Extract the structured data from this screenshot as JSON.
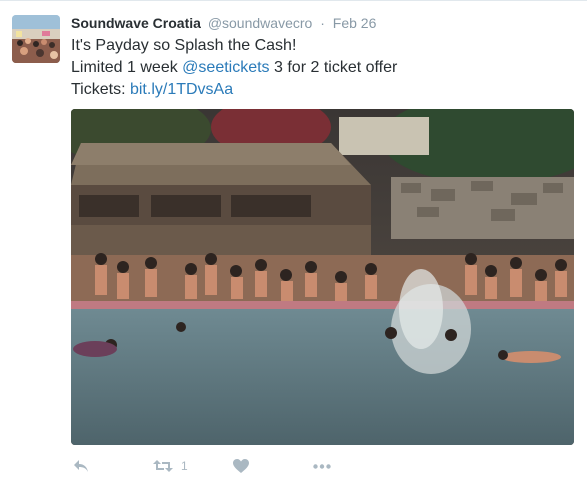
{
  "tweet": {
    "author_name": "Soundwave Croatia",
    "handle": "@soundwavecro",
    "separator": "·",
    "time": "Feb 26",
    "line1": "It's Payday so Splash the Cash!",
    "line2_prefix": "Limited 1 week ",
    "line2_mention": "@seetickets",
    "line2_suffix": " 3 for 2 ticket offer",
    "line3_prefix": "Tickets: ",
    "line3_link": "bit.ly/1TDvsAa"
  },
  "actions": {
    "reply_icon": "reply-icon",
    "retweet_icon": "retweet-icon",
    "retweet_count": "1",
    "like_icon": "heart-icon",
    "more_icon": "more-icon"
  },
  "colors": {
    "link": "#2b7bb9",
    "muted": "#8899a6",
    "icon": "#aab8c2"
  }
}
